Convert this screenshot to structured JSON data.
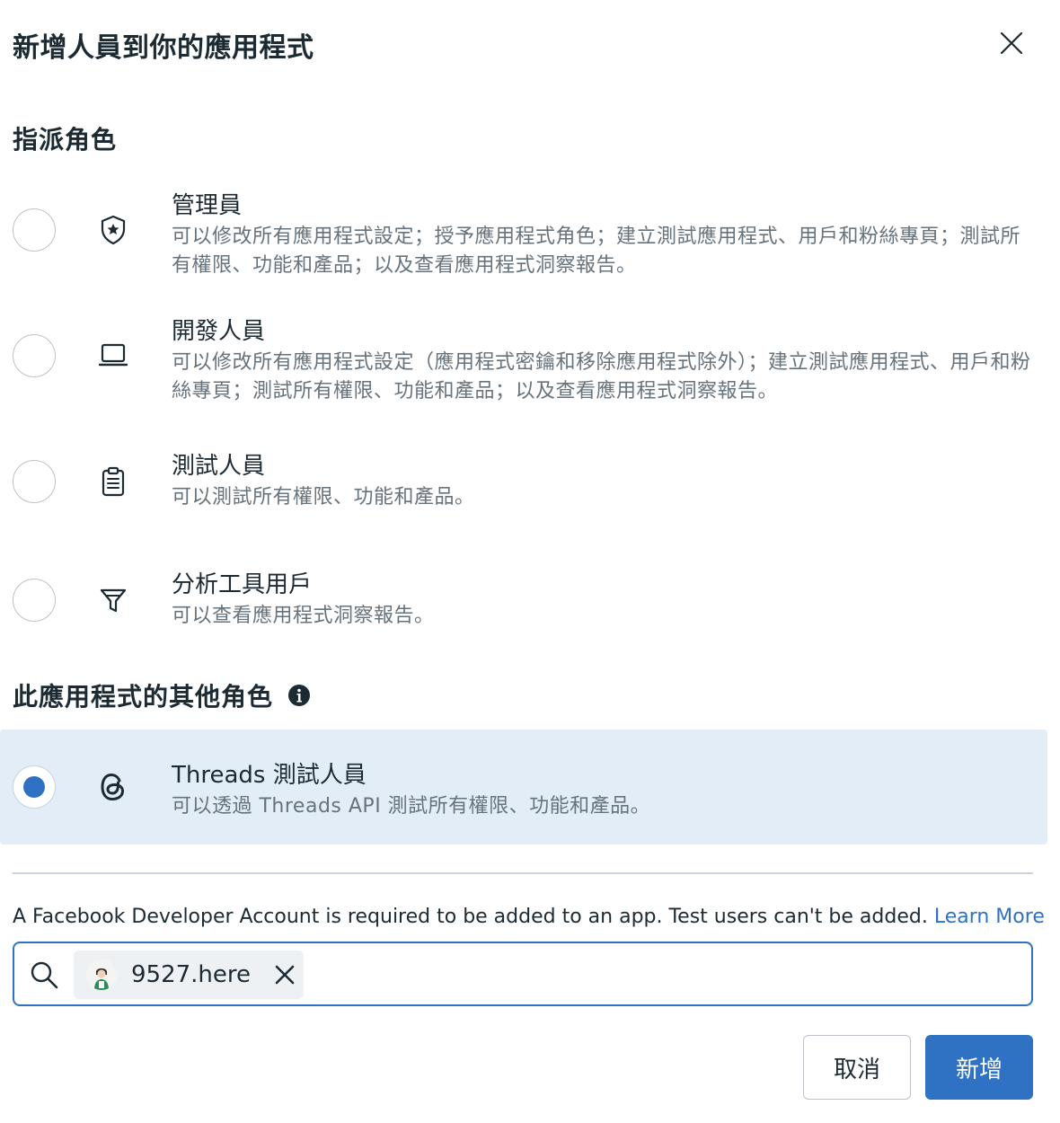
{
  "dialog": {
    "title": "新增人員到你的應用程式"
  },
  "sections": {
    "assign_role": "指派角色",
    "other_roles": "此應用程式的其他角色"
  },
  "roles": [
    {
      "name": "管理員",
      "description": "可以修改所有應用程式設定；授予應用程式角色；建立測試應用程式、用戶和粉絲專頁；測試所有權限、功能和產品；以及查看應用程式洞察報告。",
      "icon": "shield-star-icon",
      "selected": false
    },
    {
      "name": "開發人員",
      "description": "可以修改所有應用程式設定（應用程式密鑰和移除應用程式除外）；建立測試應用程式、用戶和粉絲專頁；測試所有權限、功能和產品；以及查看應用程式洞察報告。",
      "icon": "laptop-icon",
      "selected": false
    },
    {
      "name": "測試人員",
      "description": "可以測試所有權限、功能和產品。",
      "icon": "clipboard-icon",
      "selected": false
    },
    {
      "name": "分析工具用戶",
      "description": "可以查看應用程式洞察報告。",
      "icon": "funnel-icon",
      "selected": false
    }
  ],
  "other_roles": [
    {
      "name": "Threads 測試人員",
      "description": "可以透過 Threads API 測試所有權限、功能和產品。",
      "icon": "threads-icon",
      "selected": true
    }
  ],
  "notice": {
    "text": "A Facebook Developer Account is required to be added to an app. Test users can't be added.",
    "link": "Learn More"
  },
  "search": {
    "chips": [
      {
        "label": "9527.here"
      }
    ]
  },
  "buttons": {
    "cancel": "取消",
    "add": "新增"
  },
  "colors": {
    "accent": "#2f71c2",
    "selected_row": "#e3edf7",
    "text_primary": "#1c2b33",
    "text_secondary": "#66737d"
  }
}
